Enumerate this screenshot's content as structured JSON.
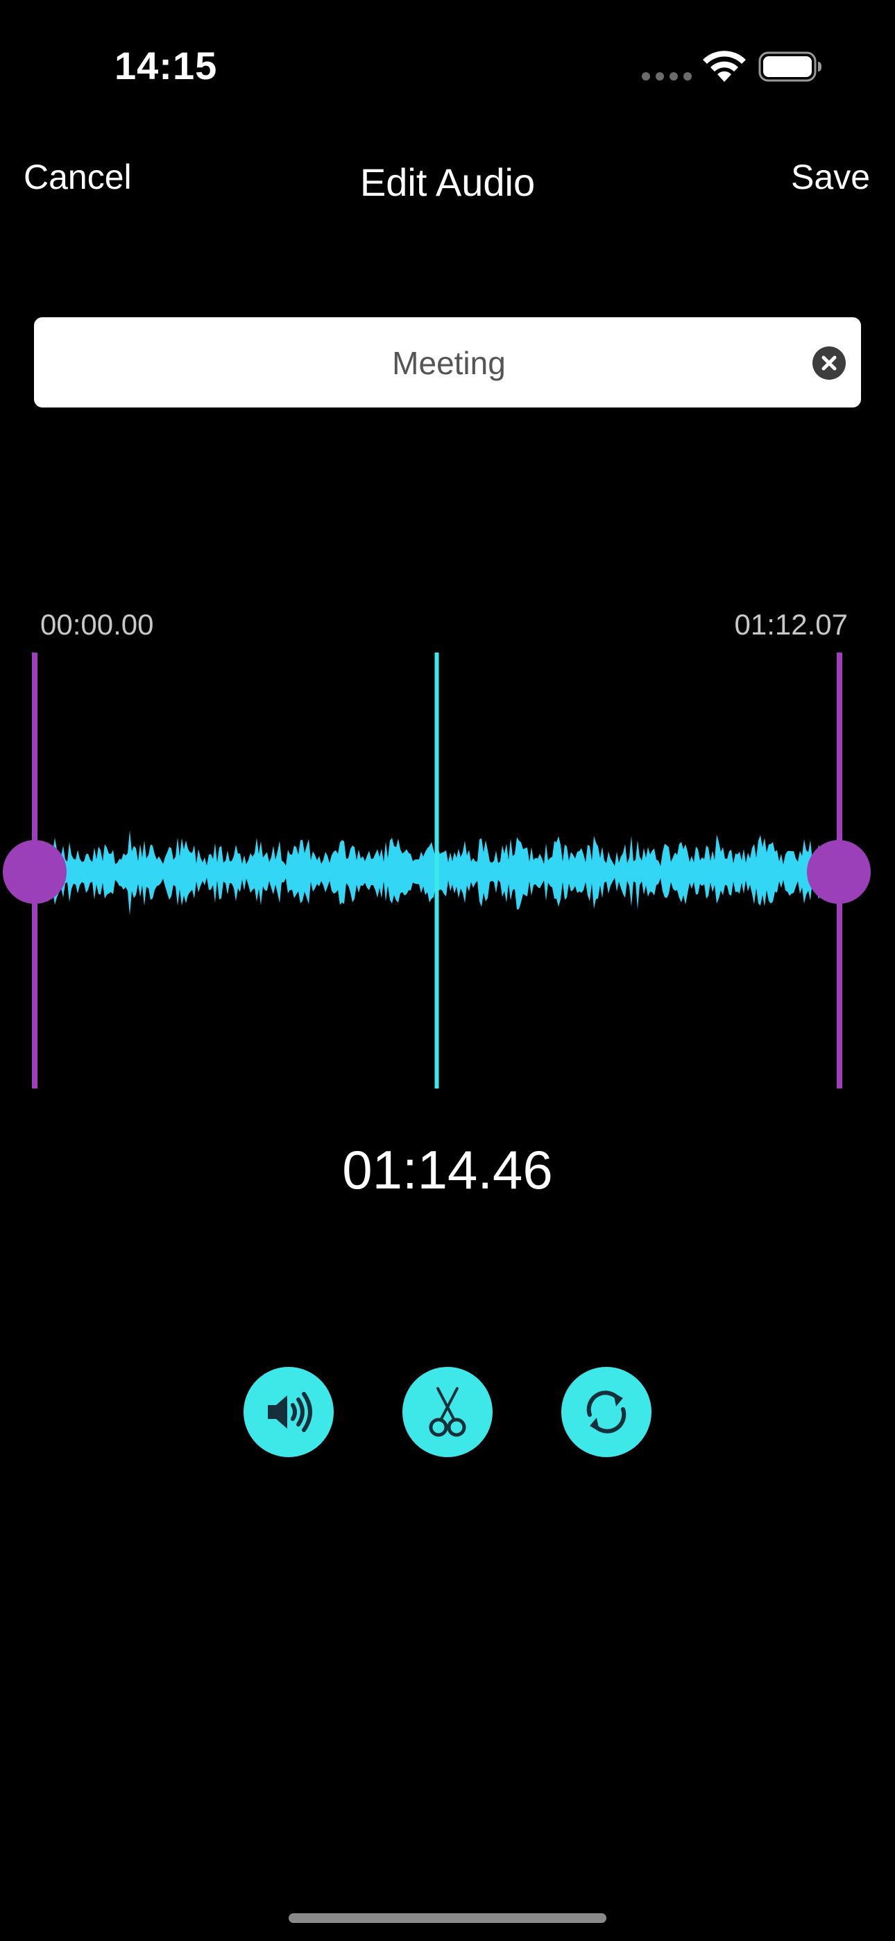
{
  "status_bar": {
    "time": "14:15",
    "icons": [
      "signal-dots-icon",
      "wifi-icon",
      "battery-icon"
    ]
  },
  "nav": {
    "cancel_label": "Cancel",
    "title": "Edit Audio",
    "save_label": "Save"
  },
  "name_field": {
    "value": "Meeting",
    "clear_icon": "clear-icon"
  },
  "timeline": {
    "start_label": "00:00.00",
    "end_label": "01:12.07",
    "current_time": "01:14.46",
    "playhead_fraction": 0.5
  },
  "controls": [
    {
      "name": "volume-button",
      "icon": "speaker-icon"
    },
    {
      "name": "trim-button",
      "icon": "scissors-icon"
    },
    {
      "name": "loop-button",
      "icon": "loop-icon"
    }
  ],
  "colors": {
    "background": "#000000",
    "waveform": "#33d6f5",
    "playhead": "#3ee8e8",
    "trim_handle": "#9b40b8",
    "control_button": "#3ee8e8",
    "control_icon": "#15303a"
  }
}
